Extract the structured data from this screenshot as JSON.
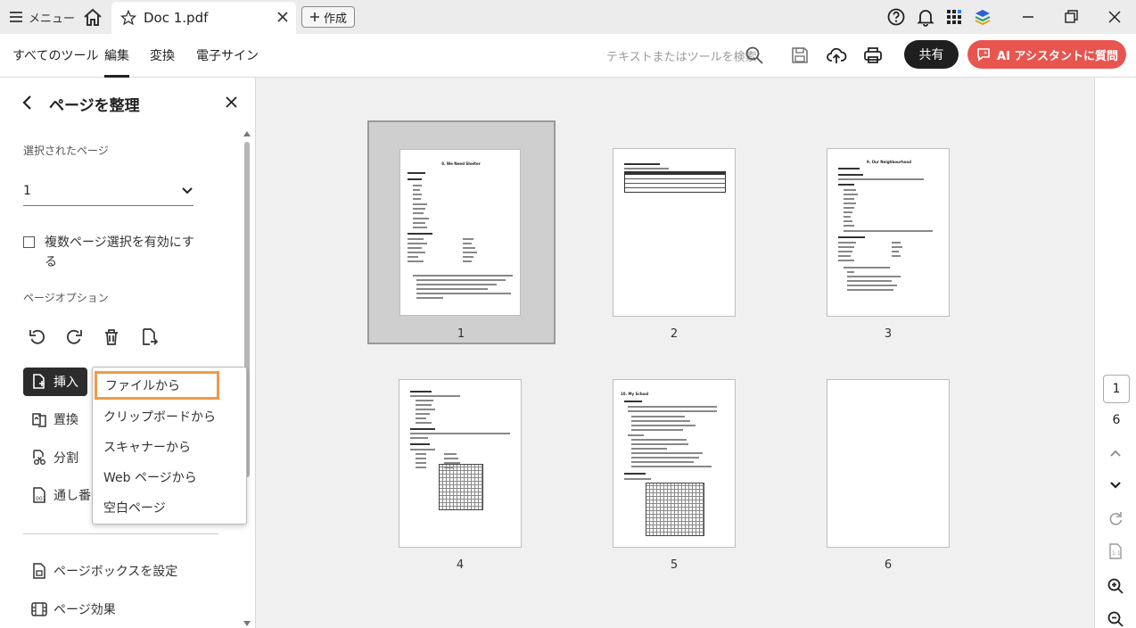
{
  "titlebar": {
    "menu_label": "メニュー",
    "doc_title": "Doc 1.pdf",
    "create_label": "作成"
  },
  "toolbar": {
    "tabs": [
      {
        "label": "すべてのツール"
      },
      {
        "label": "編集"
      },
      {
        "label": "変換"
      },
      {
        "label": "電子サイン"
      }
    ],
    "active_tab": "編集",
    "search_placeholder": "テキストまたはツールを検索",
    "share_label": "共有",
    "ai_label": "AI アシスタントに質問",
    "ai_color": "#e8554f"
  },
  "panel": {
    "title": "ページを整理",
    "selected_pages_label": "選択されたページ",
    "selected_page_value": "1",
    "multi_select_label": "複数ページ選択を有効にする",
    "page_options_label": "ページオプション",
    "insert_label": "挿入",
    "replace_label": "置換",
    "split_label": "分割",
    "numbering_label": "通し番号",
    "page_box_label": "ページボックスを設定",
    "page_effects_label": "ページ効果"
  },
  "insert_menu": {
    "items": [
      {
        "label": "ファイルから"
      },
      {
        "label": "クリップボードから"
      },
      {
        "label": "スキャナーから"
      },
      {
        "label": "Web ページから"
      },
      {
        "label": "空白ページ"
      }
    ],
    "highlight_color": "#f09a46"
  },
  "pages": [
    {
      "number": "1",
      "selected": true
    },
    {
      "number": "2"
    },
    {
      "number": "3"
    },
    {
      "number": "4"
    },
    {
      "number": "5"
    },
    {
      "number": "6"
    }
  ],
  "page_thumbnail_text": {
    "p1_title": "8. We Need Shelter",
    "p3_title": "9. Our Neighbourhood",
    "p5_title": "10. My School"
  },
  "navigation": {
    "current_page": "1",
    "total_pages": "6"
  }
}
